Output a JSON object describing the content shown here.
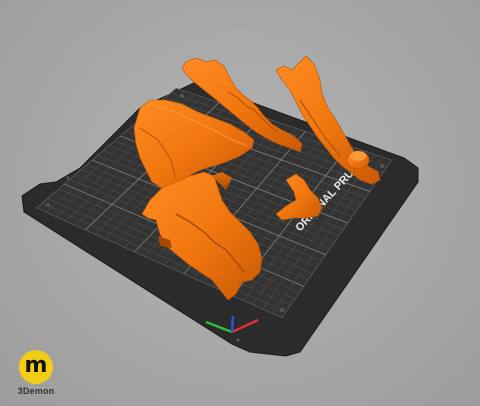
{
  "app": {
    "view": "3D print bed preview",
    "bed_text": "ORIGINAL PRUSA",
    "model_color": "#f2770f",
    "bed_color": "#2d2d2d",
    "grid_color": "#6a6a6a"
  },
  "axes": {
    "x_color": "#e03030",
    "y_color": "#30c030",
    "z_color": "#3050e0"
  },
  "watermark": {
    "logo_letter": "m",
    "brand": "3Demon",
    "logo_color": "#f2cd16"
  }
}
